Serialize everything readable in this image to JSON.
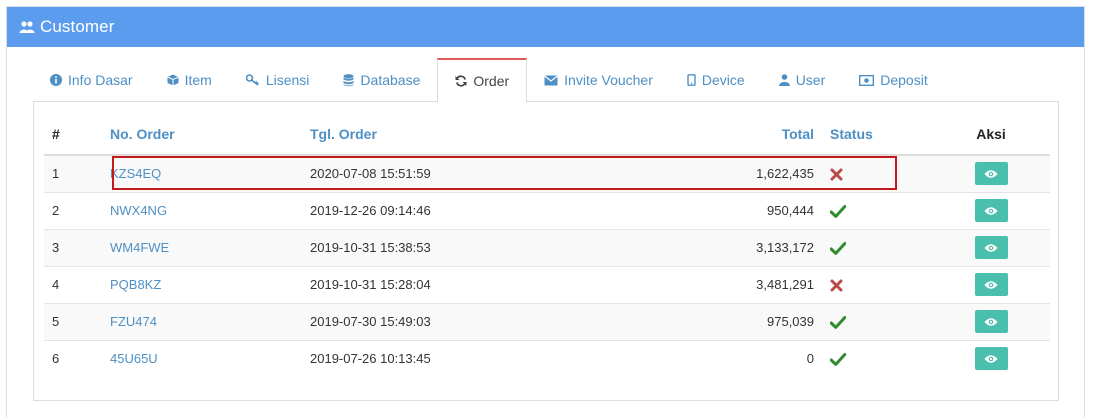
{
  "panel": {
    "title": "Customer",
    "icon": "users-icon"
  },
  "tabs": [
    {
      "label": "Info Dasar",
      "icon": "info-circle-icon"
    },
    {
      "label": "Item",
      "icon": "cube-icon"
    },
    {
      "label": "Lisensi",
      "icon": "key-icon"
    },
    {
      "label": "Database",
      "icon": "database-icon"
    },
    {
      "label": "Order",
      "icon": "refresh-icon",
      "active": true
    },
    {
      "label": "Invite Voucher",
      "icon": "envelope-icon"
    },
    {
      "label": "Device",
      "icon": "mobile-icon"
    },
    {
      "label": "User",
      "icon": "user-icon"
    },
    {
      "label": "Deposit",
      "icon": "money-icon"
    }
  ],
  "table": {
    "headers": {
      "num": "#",
      "order": "No. Order",
      "date": "Tgl. Order",
      "total": "Total",
      "status": "Status",
      "aksi": "Aksi"
    },
    "rows": [
      {
        "num": "1",
        "order": "KZS4EQ",
        "date": "2020-07-08 15:51:59",
        "total": "1,622,435",
        "status": "cross"
      },
      {
        "num": "2",
        "order": "NWX4NG",
        "date": "2019-12-26 09:14:46",
        "total": "950,444",
        "status": "check"
      },
      {
        "num": "3",
        "order": "WM4FWE",
        "date": "2019-10-31 15:38:53",
        "total": "3,133,172",
        "status": "check"
      },
      {
        "num": "4",
        "order": "PQB8KZ",
        "date": "2019-10-31 15:28:04",
        "total": "3,481,291",
        "status": "cross"
      },
      {
        "num": "5",
        "order": "FZU474",
        "date": "2019-07-30 15:49:03",
        "total": "975,039",
        "status": "check"
      },
      {
        "num": "6",
        "order": "45U65U",
        "date": "2019-07-26 10:13:45",
        "total": "0",
        "status": "check"
      }
    ]
  },
  "colors": {
    "header": "#5b9cef",
    "link": "#4e8fc4",
    "view_button": "#4bbfad",
    "check": "#2e8b2e",
    "cross": "#b94a48",
    "highlight": "#c61a1a"
  }
}
